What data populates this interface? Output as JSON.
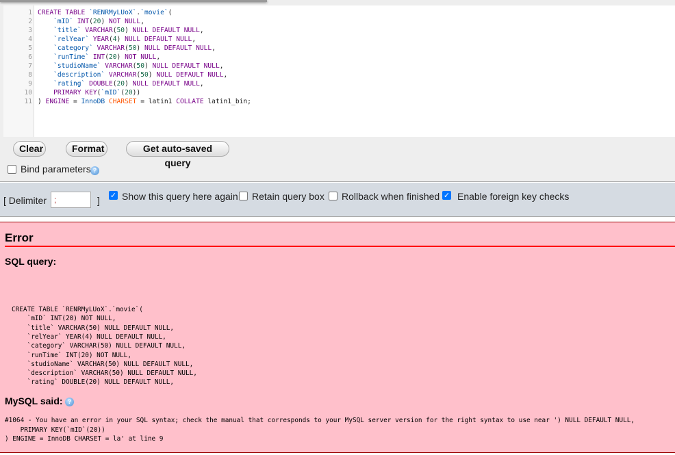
{
  "editor": {
    "lines": [
      [
        [
          "CREATE TABLE ",
          "kw"
        ],
        [
          "`RENRMyLUoX`",
          "var"
        ],
        [
          ".",
          "op"
        ],
        [
          "`movie`",
          "var"
        ],
        [
          "(",
          "op"
        ]
      ],
      [
        [
          "    `mID` ",
          "var"
        ],
        [
          "INT",
          "kw"
        ],
        [
          "(",
          "op"
        ],
        [
          "20",
          "num"
        ],
        [
          ") ",
          "op"
        ],
        [
          "NOT NULL",
          "kw"
        ],
        [
          ",",
          "op"
        ]
      ],
      [
        [
          "    `title` ",
          "var"
        ],
        [
          "VARCHAR",
          "kw"
        ],
        [
          "(",
          "op"
        ],
        [
          "50",
          "num"
        ],
        [
          ") ",
          "op"
        ],
        [
          "NULL DEFAULT NULL",
          "kw"
        ],
        [
          ",",
          "op"
        ]
      ],
      [
        [
          "    `relYear` ",
          "var"
        ],
        [
          "YEAR",
          "kw"
        ],
        [
          "(",
          "op"
        ],
        [
          "4",
          "num"
        ],
        [
          ") ",
          "op"
        ],
        [
          "NULL DEFAULT NULL",
          "kw"
        ],
        [
          ",",
          "op"
        ]
      ],
      [
        [
          "    `category` ",
          "var"
        ],
        [
          "VARCHAR",
          "kw"
        ],
        [
          "(",
          "op"
        ],
        [
          "50",
          "num"
        ],
        [
          ") ",
          "op"
        ],
        [
          "NULL DEFAULT NULL",
          "kw"
        ],
        [
          ",",
          "op"
        ]
      ],
      [
        [
          "    `runTime` ",
          "var"
        ],
        [
          "INT",
          "kw"
        ],
        [
          "(",
          "op"
        ],
        [
          "20",
          "num"
        ],
        [
          ") ",
          "op"
        ],
        [
          "NOT NULL",
          "kw"
        ],
        [
          ",",
          "op"
        ]
      ],
      [
        [
          "    `studioName` ",
          "var"
        ],
        [
          "VARCHAR",
          "kw"
        ],
        [
          "(",
          "op"
        ],
        [
          "50",
          "num"
        ],
        [
          ") ",
          "op"
        ],
        [
          "NULL DEFAULT NULL",
          "kw"
        ],
        [
          ",",
          "op"
        ]
      ],
      [
        [
          "    `description` ",
          "var"
        ],
        [
          "VARCHAR",
          "kw"
        ],
        [
          "(",
          "op"
        ],
        [
          "50",
          "num"
        ],
        [
          ") ",
          "op"
        ],
        [
          "NULL DEFAULT NULL",
          "kw"
        ],
        [
          ",",
          "op"
        ]
      ],
      [
        [
          "    `rating` ",
          "var"
        ],
        [
          "DOUBLE",
          "kw"
        ],
        [
          "(",
          "op"
        ],
        [
          "20",
          "num"
        ],
        [
          ") ",
          "op"
        ],
        [
          "NULL DEFAULT NULL",
          "kw"
        ],
        [
          ",",
          "op"
        ]
      ],
      [
        [
          "    PRIMARY KEY",
          "kw"
        ],
        [
          "(",
          "op"
        ],
        [
          "`mID`",
          "var"
        ],
        [
          "(",
          "op"
        ],
        [
          "20",
          "num"
        ],
        [
          "))",
          "op"
        ]
      ],
      [
        [
          ") ",
          "op"
        ],
        [
          "ENGINE",
          "kw"
        ],
        [
          " = ",
          "op"
        ],
        [
          "InnoDB ",
          "var"
        ],
        [
          "CHARSET",
          "orange"
        ],
        [
          " = latin1 ",
          "op"
        ],
        [
          "COLLATE",
          "kw"
        ],
        [
          " latin1_bin;",
          "op"
        ]
      ]
    ]
  },
  "buttons": {
    "clear": "Clear",
    "format": "Format",
    "autosaved": "Get auto-saved query"
  },
  "bind_parameters": {
    "label": "Bind parameters",
    "checked": false
  },
  "options": {
    "delimiter_label_open": "[ Delimiter",
    "delimiter_value": ";",
    "delimiter_close": "]",
    "show_again": "Show this query here again",
    "retain": "Retain query box",
    "rollback": "Rollback when finished",
    "foreign_keys": "Enable foreign key checks"
  },
  "error": {
    "title": "Error",
    "sql_label": "SQL query:",
    "sql_lines": [
      "CREATE TABLE `RENRMyLUoX`.`movie`(",
      "    `mID` INT(20) NOT NULL,",
      "    `title` VARCHAR(50) NULL DEFAULT NULL,",
      "    `relYear` YEAR(4) NULL DEFAULT NULL,",
      "    `category` VARCHAR(50) NULL DEFAULT NULL,",
      "    `runTime` INT(20) NOT NULL,",
      "    `studioName` VARCHAR(50) NULL DEFAULT NULL,",
      "    `description` VARCHAR(50) NULL DEFAULT NULL,",
      "    `rating` DOUBLE(20) NULL DEFAULT NULL,"
    ],
    "mysql_said": "MySQL said:",
    "message_lines": [
      "#1064 - You have an error in your SQL syntax; check the manual that corresponds to your MySQL server version for the right syntax to use near ') NULL DEFAULT NULL,",
      "    PRIMARY KEY(`mID`(20))",
      ") ENGINE = InnoDB CHARSET = la' at line 9"
    ]
  },
  "colors": {
    "error_bg": "#ffc0cb",
    "error_rule": "#ff0000",
    "options_bg": "#d5dbe2",
    "checkbox_on": "#0075ff"
  }
}
